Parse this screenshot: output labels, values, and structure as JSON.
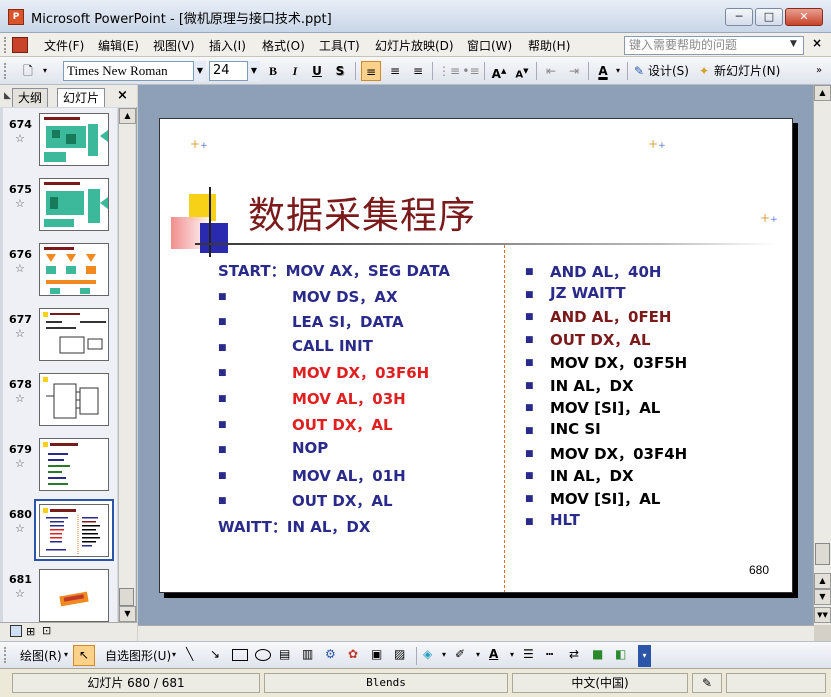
{
  "window": {
    "title": "Microsoft PowerPoint - [微机原理与接口技术.ppt]",
    "min": "─",
    "max": "□",
    "close": "✕"
  },
  "menu": {
    "items": [
      "文件(F)",
      "编辑(E)",
      "视图(V)",
      "插入(I)",
      "格式(O)",
      "工具(T)",
      "幻灯片放映(D)",
      "窗口(W)",
      "帮助(H)"
    ],
    "help_placeholder": "键入需要帮助的问题",
    "doc_close": "×"
  },
  "toolbar": {
    "font": "Times New Roman",
    "size": "24",
    "bold": "B",
    "italic": "I",
    "underline": "U",
    "shadow": "S",
    "design": "设计(S)",
    "new_slide": "新幻灯片(N)"
  },
  "pane": {
    "tab_outline": "大纲",
    "tab_slides": "幻灯片",
    "close": "×",
    "thumbnails": [
      {
        "num": "674",
        "star": "☆"
      },
      {
        "num": "675",
        "star": "☆"
      },
      {
        "num": "676",
        "star": "☆"
      },
      {
        "num": "677",
        "star": "☆"
      },
      {
        "num": "678",
        "star": "☆"
      },
      {
        "num": "679",
        "star": "☆"
      },
      {
        "num": "680",
        "star": "☆"
      },
      {
        "num": "681",
        "star": "☆"
      }
    ],
    "selected": "680"
  },
  "slide": {
    "title": "数据采集程序",
    "page_number": "680",
    "left_lines": [
      {
        "bullet": "",
        "label": "START：MOV AX，SEG DATA",
        "color": "blue"
      },
      {
        "bullet": "■",
        "label": "MOV DS，AX",
        "color": "blue"
      },
      {
        "bullet": "■",
        "label": "LEA  SI，DATA",
        "color": "blue"
      },
      {
        "bullet": "■",
        "label": "CALL INIT",
        "color": "blue"
      },
      {
        "bullet": "■",
        "label": "MOV DX，03F6H",
        "color": "red"
      },
      {
        "bullet": "■",
        "label": "MOV AL，03H",
        "color": "red"
      },
      {
        "bullet": "■",
        "label": "OUT DX，AL",
        "color": "red"
      },
      {
        "bullet": "■",
        "label": "NOP",
        "color": "blue"
      },
      {
        "bullet": "■",
        "label": "MOV AL，01H",
        "color": "blue"
      },
      {
        "bullet": "■",
        "label": "OUT DX，AL",
        "color": "blue"
      },
      {
        "bullet": "",
        "label": "WAITT：IN AL，DX",
        "color": "blue"
      }
    ],
    "right_lines": [
      {
        "label": "AND AL，40H",
        "color": "blue"
      },
      {
        "label": "JZ  WAITT",
        "color": "blue"
      },
      {
        "label": "AND AL，0FEH",
        "color": "dark"
      },
      {
        "label": "OUT DX，AL",
        "color": "dark"
      },
      {
        "label": "MOV DX，03F5H",
        "color": "black"
      },
      {
        "label": "IN AL，DX",
        "color": "black"
      },
      {
        "label": "MOV [SI]，AL",
        "color": "black"
      },
      {
        "label": "INC SI",
        "color": "black"
      },
      {
        "label": "MOV DX，03F4H",
        "color": "black"
      },
      {
        "label": "IN AL，DX",
        "color": "black"
      },
      {
        "label": "MOV [SI]，AL",
        "color": "black"
      },
      {
        "label": "HLT",
        "color": "blue"
      }
    ]
  },
  "drawbar": {
    "draw": "绘图(R)",
    "autoshapes": "自选图形(U)"
  },
  "status": {
    "slide": "幻灯片 680 / 681",
    "template": "Blends",
    "language": "中文(中国)"
  },
  "colors": {
    "blue": "#2a2a8a",
    "red": "#e02020",
    "dark": "#7a1a1a",
    "black": "#000000"
  }
}
